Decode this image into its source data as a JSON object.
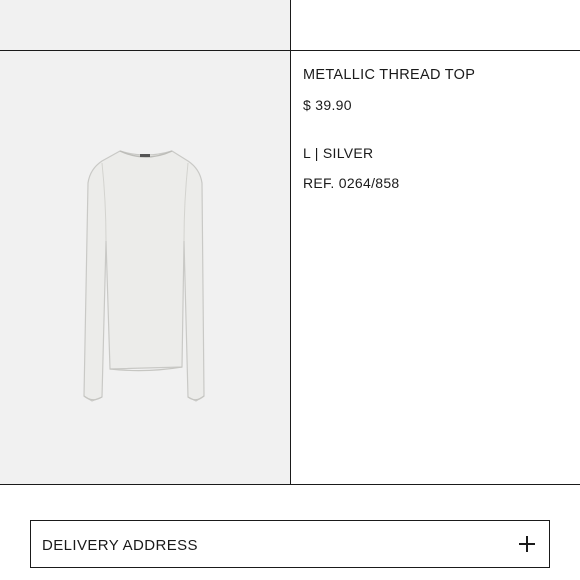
{
  "product": {
    "name": "METALLIC THREAD TOP",
    "price": "$ 39.90",
    "variant": "L | SILVER",
    "reference": "REF. 0264/858",
    "image_alt": "silver metallic thread long sleeve top"
  },
  "delivery": {
    "label": "DELIVERY ADDRESS",
    "icon": "plus-icon"
  },
  "colors": {
    "border": "#1a1a1a",
    "image_background": "#f1f1f1",
    "garment": "#ececea"
  }
}
